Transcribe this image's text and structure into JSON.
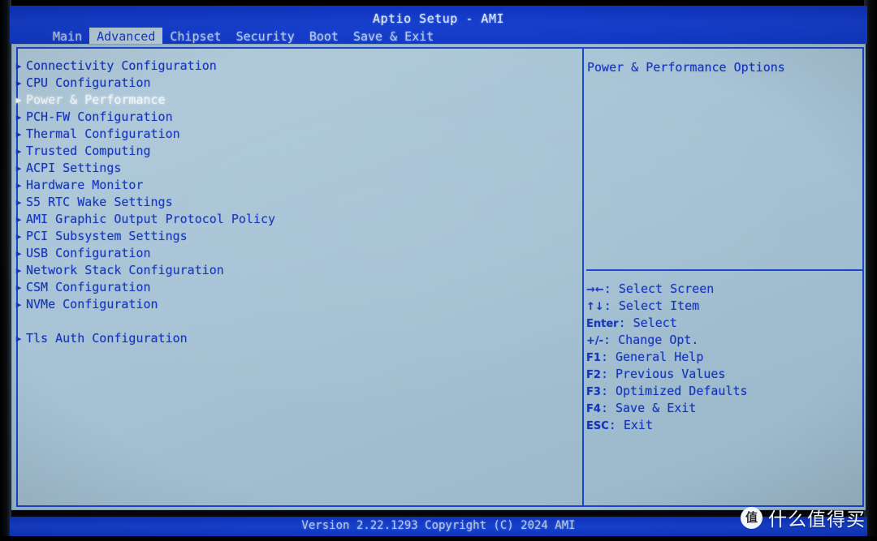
{
  "header": {
    "title": "Aptio Setup - AMI",
    "tabs": [
      {
        "label": "Main",
        "active": false
      },
      {
        "label": "Advanced",
        "active": true
      },
      {
        "label": "Chipset",
        "active": false
      },
      {
        "label": "Security",
        "active": false
      },
      {
        "label": "Boot",
        "active": false
      },
      {
        "label": "Save & Exit",
        "active": false
      }
    ]
  },
  "menu": {
    "items": [
      {
        "label": "Connectivity Configuration",
        "selected": false,
        "spacer_before": false
      },
      {
        "label": "CPU Configuration",
        "selected": false,
        "spacer_before": false
      },
      {
        "label": "Power & Performance",
        "selected": true,
        "spacer_before": false
      },
      {
        "label": "PCH-FW Configuration",
        "selected": false,
        "spacer_before": false
      },
      {
        "label": "Thermal Configuration",
        "selected": false,
        "spacer_before": false
      },
      {
        "label": "Trusted Computing",
        "selected": false,
        "spacer_before": false
      },
      {
        "label": "ACPI Settings",
        "selected": false,
        "spacer_before": false
      },
      {
        "label": "Hardware Monitor",
        "selected": false,
        "spacer_before": false
      },
      {
        "label": "S5 RTC Wake Settings",
        "selected": false,
        "spacer_before": false
      },
      {
        "label": "AMI Graphic Output Protocol Policy",
        "selected": false,
        "spacer_before": false
      },
      {
        "label": "PCI Subsystem Settings",
        "selected": false,
        "spacer_before": false
      },
      {
        "label": "USB Configuration",
        "selected": false,
        "spacer_before": false
      },
      {
        "label": "Network Stack Configuration",
        "selected": false,
        "spacer_before": false
      },
      {
        "label": "CSM Configuration",
        "selected": false,
        "spacer_before": false
      },
      {
        "label": "NVMe Configuration",
        "selected": false,
        "spacer_before": false
      },
      {
        "label": "Tls Auth Configuration",
        "selected": false,
        "spacer_before": true
      }
    ],
    "arrow_glyph": "▶"
  },
  "help": {
    "text": "Power & Performance Options"
  },
  "keys": [
    {
      "glyph": "→←",
      "text": ": Select Screen"
    },
    {
      "glyph": "↑↓",
      "text": ": Select Item"
    },
    {
      "glyph": "Enter",
      "text": ": Select"
    },
    {
      "glyph": "+/-",
      "text": ": Change Opt."
    },
    {
      "glyph": "F1",
      "text": ": General Help"
    },
    {
      "glyph": "F2",
      "text": ": Previous Values"
    },
    {
      "glyph": "F3",
      "text": ": Optimized Defaults"
    },
    {
      "glyph": "F4",
      "text": ": Save & Exit"
    },
    {
      "glyph": "ESC",
      "text": ": Exit"
    }
  ],
  "footer": {
    "version_text": "Version 2.22.1293 Copyright (C) 2024 AMI"
  },
  "watermark": {
    "logo_char": "值",
    "text": "什么值得买"
  },
  "colors": {
    "header_blue": "#1138c6",
    "panel_bg": "#a8c4d6",
    "text_blue": "#1535bd",
    "selected_white": "#f2f7fb",
    "active_tab_bg": "#b7ccd9",
    "border_blue": "#1c45cf"
  }
}
